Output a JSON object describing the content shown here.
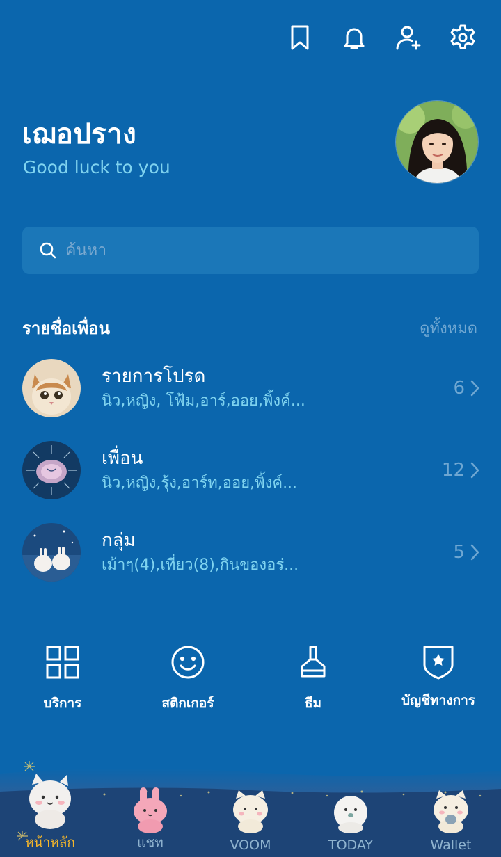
{
  "header": {
    "icons": [
      "bookmark-icon",
      "bell-icon",
      "add-friend-icon",
      "gear-icon"
    ]
  },
  "profile": {
    "name": "เฌอปราง",
    "status": "Good luck to you"
  },
  "search": {
    "placeholder": "ค้นหา"
  },
  "friends_section": {
    "title": "รายชื่อเพื่อน",
    "see_all": "ดูทั้งหมด",
    "rows": [
      {
        "title": "รายการโปรด",
        "members": "นิว,หญิง, โฟ้ม,อาร์,ออย,พิ้งค์...",
        "count": "6"
      },
      {
        "title": "เพื่อน",
        "members": "นิว,หญิง,รุ้ง,อาร์ท,ออย,พิ้งค์...",
        "count": "12"
      },
      {
        "title": "กลุ่ม",
        "members": "เม้าๆ(4),เที่ยว(8),กินของอร่...",
        "count": "5"
      }
    ]
  },
  "quick_actions": [
    {
      "label": "บริการ",
      "icon": "grid-icon"
    },
    {
      "label": "สติกเกอร์",
      "icon": "smiley-icon"
    },
    {
      "label": "ธีม",
      "icon": "brush-icon"
    },
    {
      "label": "บัญชีทางการ",
      "icon": "shield-star-icon"
    }
  ],
  "tabbar": {
    "tabs": [
      {
        "label": "หน้าหลัก",
        "active": true
      },
      {
        "label": "แชท",
        "active": false
      },
      {
        "label": "VOOM",
        "active": false
      },
      {
        "label": "TODAY",
        "active": false
      },
      {
        "label": "Wallet",
        "active": false
      }
    ]
  },
  "colors": {
    "background": "#0b66ad",
    "accent_text": "#7fd3ef",
    "muted_text": "#6fa7d2",
    "active_tab": "#f4b62b"
  }
}
